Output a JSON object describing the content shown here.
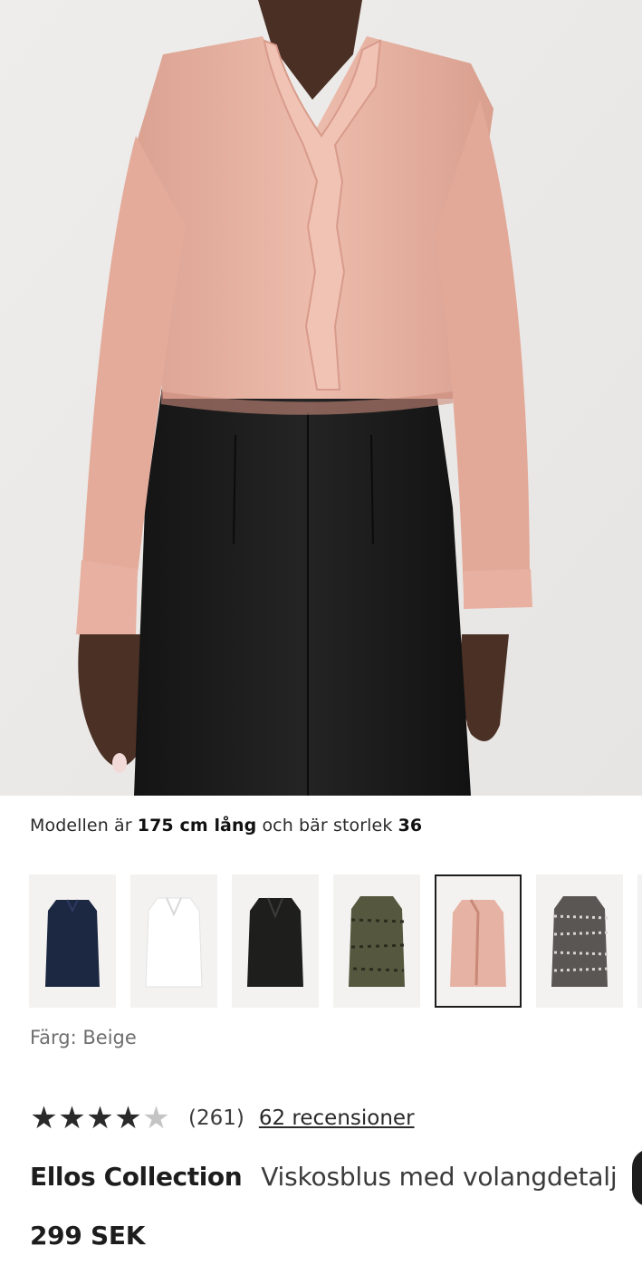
{
  "hero": {
    "alt_name": "product-model-photo"
  },
  "model_info": {
    "prefix": "Modellen är",
    "height": "175 cm lång",
    "middle": "och bär storlek",
    "size": "36"
  },
  "swatches": [
    {
      "name": "navy",
      "color": "#1c2741"
    },
    {
      "name": "white",
      "color": "#fbfbfb"
    },
    {
      "name": "black",
      "color": "#1e1f1c"
    },
    {
      "name": "green-print",
      "color": "#55573e"
    },
    {
      "name": "beige",
      "color": "#e6b2a3",
      "selected": true
    },
    {
      "name": "black-white-print",
      "color": "#5a5654"
    }
  ],
  "color_label": "Färg: Beige",
  "rating": {
    "stars": 4,
    "max": 5,
    "count": "(261)",
    "reviews_link": "62 recensioner"
  },
  "product": {
    "brand": "Ellos Collection",
    "name": "Viskosblus med volangdetalj",
    "price": "299 SEK"
  },
  "colors": {
    "accent": "#1d1d1d",
    "blouse": "#e9b1a2",
    "background": "#ebe9e7"
  }
}
